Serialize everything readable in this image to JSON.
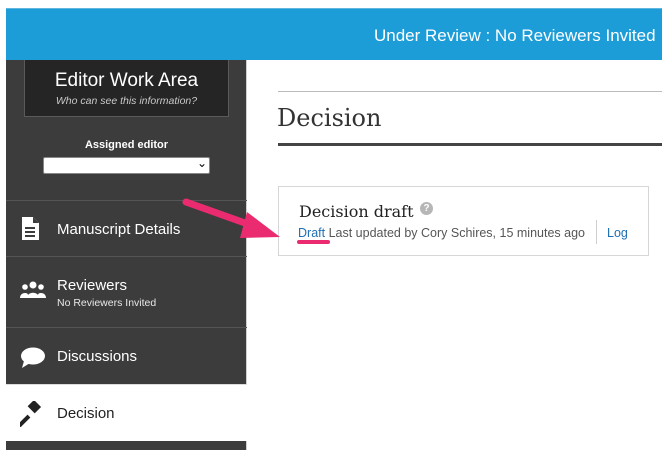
{
  "header": {
    "status_text": "Under Review : No Reviewers Invited"
  },
  "sidebar": {
    "work_area_title": "Editor Work Area",
    "work_area_subtitle": "Who can see this information?",
    "assigned_editor_label": "Assigned editor",
    "assigned_editor_value": "",
    "items": [
      {
        "label": "Manuscript Details",
        "icon": "document-icon"
      },
      {
        "label": "Reviewers",
        "sublabel": "No Reviewers Invited",
        "icon": "people-icon"
      },
      {
        "label": "Discussions",
        "icon": "chat-bubble-icon"
      },
      {
        "label": "Decision",
        "icon": "gavel-icon",
        "active": true
      }
    ]
  },
  "main": {
    "title": "Decision",
    "draft_card": {
      "title": "Decision draft",
      "draft_link": "Draft",
      "last_updated": "Last updated by Cory Schires, 15 minutes ago",
      "log_link": "Log"
    }
  },
  "colors": {
    "header_bg": "#1d9dd8",
    "sidebar_bg": "#3c3c3c",
    "annotation": "#ea2b6f",
    "link": "#1f6fb4"
  }
}
